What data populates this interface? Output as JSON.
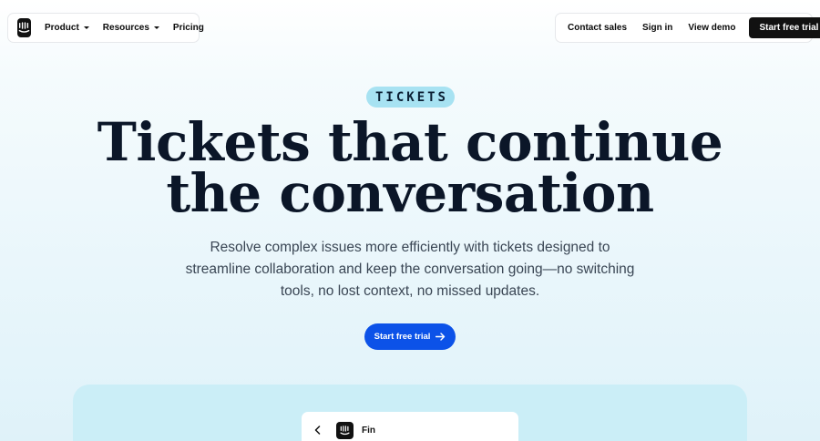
{
  "nav": {
    "logo": "intercom-logo-icon",
    "items": [
      {
        "label": "Product",
        "dropdown": true
      },
      {
        "label": "Resources",
        "dropdown": true
      },
      {
        "label": "Pricing",
        "dropdown": false
      }
    ],
    "right": {
      "contact_sales": "Contact sales",
      "sign_in": "Sign in",
      "view_demo": "View demo",
      "cta": "Start free trial"
    }
  },
  "hero": {
    "badge": "TICKETS",
    "headline_lines": [
      "Tickets that continue",
      "the conversation"
    ],
    "subtitle_lines": [
      "Resolve complex issues more efficiently with tickets designed to",
      "streamline collaboration and keep the conversation going—no switching",
      "tools, no lost context, no missed updates."
    ],
    "cta": "Start free trial"
  },
  "preview": {
    "card_title": "Fin",
    "back_icon": "chevron-left-icon",
    "logo_icon": "intercom-logo-icon"
  },
  "colors": {
    "badge_bg": "#a7e2f2",
    "cta_blue": "#0c52e8",
    "nav_cta_bg": "#111111",
    "preview_bg": "#cbeef7"
  }
}
